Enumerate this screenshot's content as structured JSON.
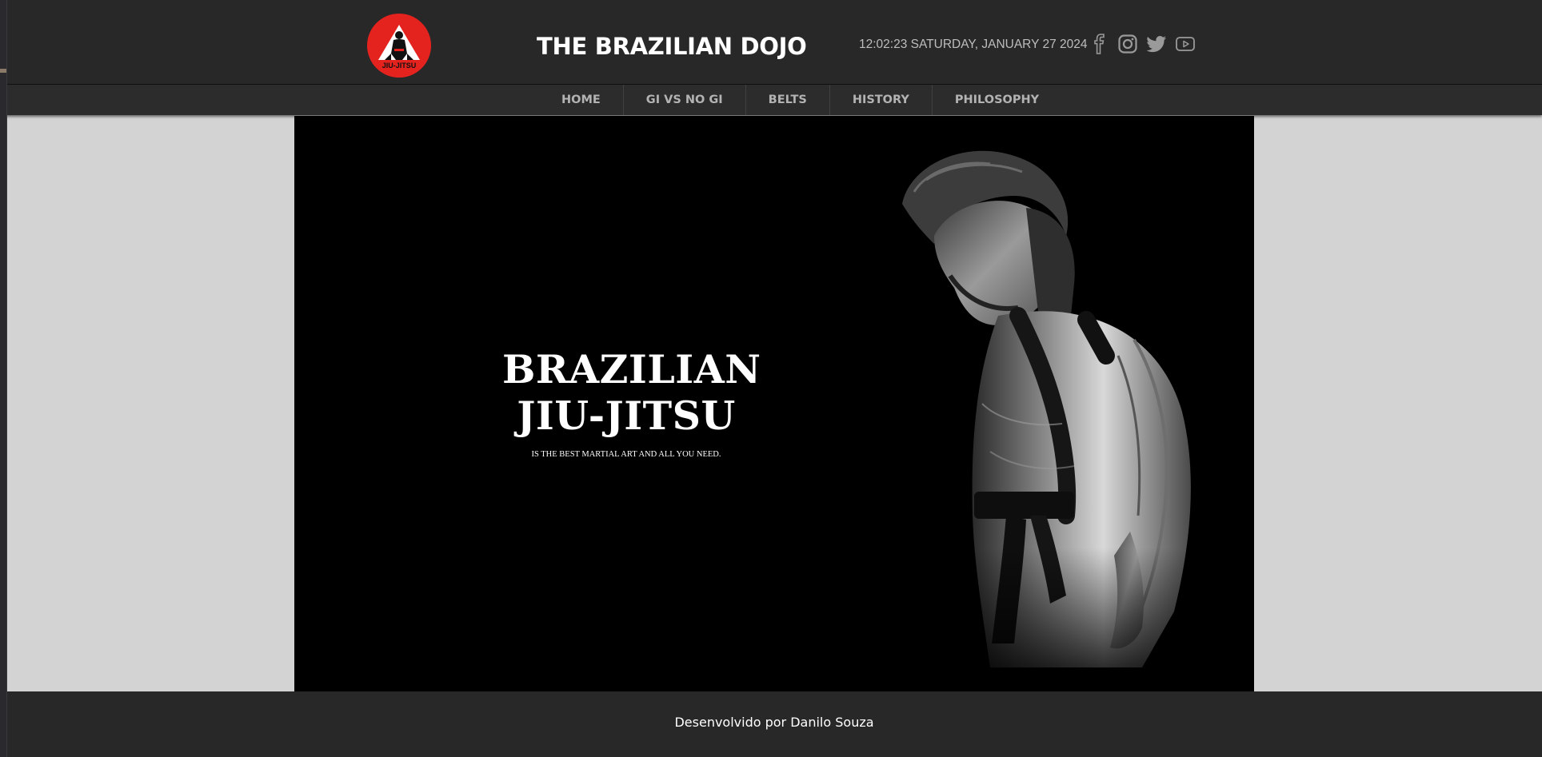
{
  "header": {
    "site_title": "THE BRAZILIAN DOJO",
    "datetime": "12:02:23 SATURDAY, JANUARY 27 2024",
    "logo": {
      "text": "JIU-JITSU",
      "icon": "jiu-jitsu-fighter-emblem",
      "background_color": "#e4231f"
    },
    "social_icons": [
      "facebook-icon",
      "instagram-icon",
      "twitter-icon",
      "youtube-icon"
    ]
  },
  "nav": {
    "items": [
      {
        "label": "HOME"
      },
      {
        "label": "GI VS NO GI"
      },
      {
        "label": "BELTS"
      },
      {
        "label": "HISTORY"
      },
      {
        "label": "PHILOSOPHY"
      }
    ]
  },
  "hero": {
    "title_line1": "BRAZILIAN",
    "title_line2": "JIU-JITSU",
    "subtitle": "IS THE BEST MARTIAL ART AND ALL YOU NEED.",
    "image": "bjj-athlete-in-gi-black-and-white"
  },
  "footer": {
    "credit": "Desenvolvido por Danilo Souza"
  },
  "colors": {
    "header_bg": "#282828",
    "nav_bg": "#2c2c2c",
    "page_bg": "#d3d3d3",
    "hero_bg": "#000000",
    "nav_text": "#b3b3b3",
    "logo_red": "#e4231f"
  }
}
